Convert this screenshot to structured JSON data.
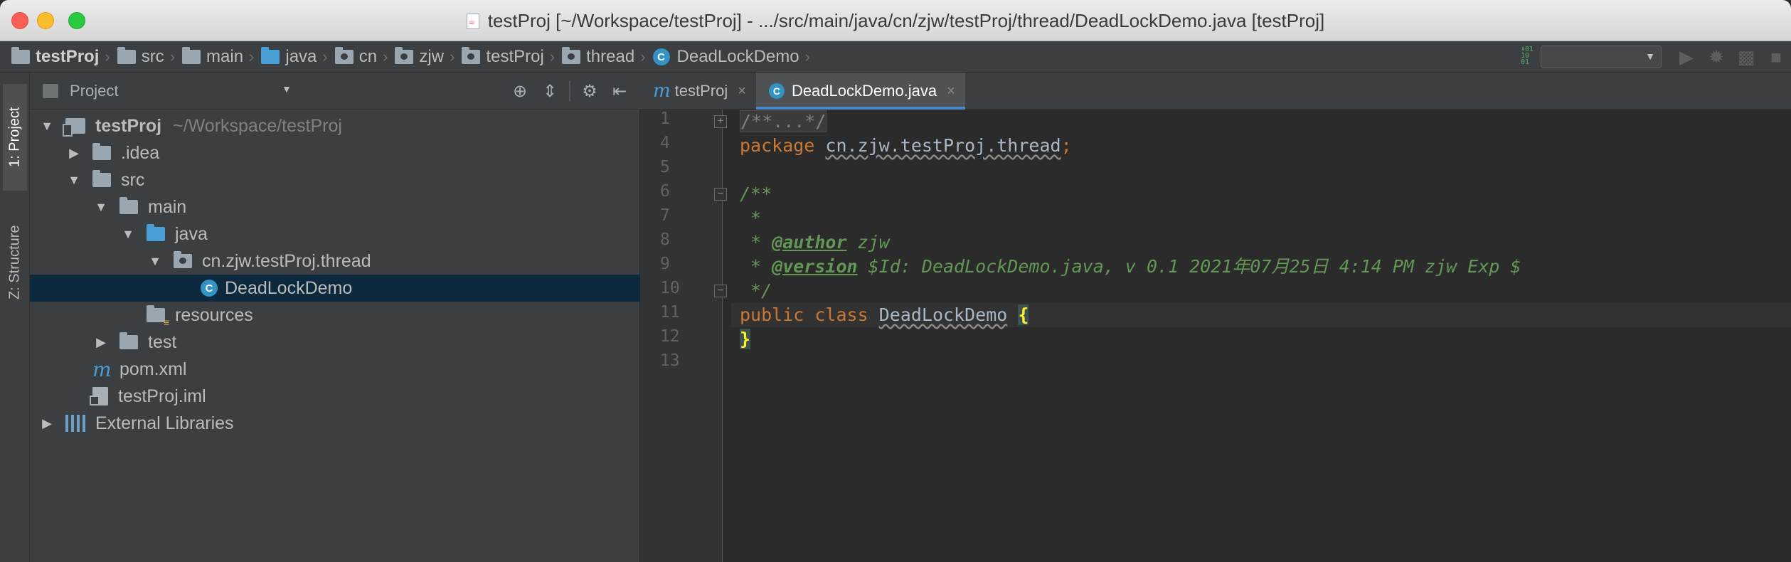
{
  "window": {
    "title": "testProj [~/Workspace/testProj] - .../src/main/java/cn/zjw/testProj/thread/DeadLockDemo.java [testProj]"
  },
  "breadcrumbs": [
    {
      "label": "testProj",
      "icon": "module-folder-icon",
      "bold": true
    },
    {
      "label": "src",
      "icon": "folder-icon"
    },
    {
      "label": "main",
      "icon": "folder-icon"
    },
    {
      "label": "java",
      "icon": "source-folder-icon"
    },
    {
      "label": "cn",
      "icon": "package-icon"
    },
    {
      "label": "zjw",
      "icon": "package-icon"
    },
    {
      "label": "testProj",
      "icon": "package-icon"
    },
    {
      "label": "thread",
      "icon": "package-icon"
    },
    {
      "label": "DeadLockDemo",
      "icon": "class-icon"
    }
  ],
  "left_tool_tabs": {
    "project": "1: Project",
    "structure": "Z: Structure"
  },
  "project_panel": {
    "title": "Project",
    "tree": [
      {
        "label": "testProj",
        "suffix": "~/Workspace/testProj",
        "level": 0,
        "expanded": true,
        "icon": "module-folder-icon"
      },
      {
        "label": ".idea",
        "level": 1,
        "expanded": false,
        "icon": "folder-icon"
      },
      {
        "label": "src",
        "level": 1,
        "expanded": true,
        "icon": "folder-icon"
      },
      {
        "label": "main",
        "level": 2,
        "expanded": true,
        "icon": "folder-icon"
      },
      {
        "label": "java",
        "level": 3,
        "expanded": true,
        "icon": "source-folder-icon"
      },
      {
        "label": "cn.zjw.testProj.thread",
        "level": 4,
        "expanded": true,
        "icon": "package-icon"
      },
      {
        "label": "DeadLockDemo",
        "level": 5,
        "icon": "class-icon",
        "selected": true
      },
      {
        "label": "resources",
        "level": 3,
        "icon": "resources-folder-icon"
      },
      {
        "label": "test",
        "level": 2,
        "expanded": false,
        "icon": "folder-icon"
      },
      {
        "label": "pom.xml",
        "level": 1,
        "icon": "maven-icon"
      },
      {
        "label": "testProj.iml",
        "level": 1,
        "icon": "iml-file-icon"
      },
      {
        "label": "External Libraries",
        "level": 0,
        "expanded": false,
        "icon": "libraries-icon"
      }
    ]
  },
  "editor": {
    "tabs": [
      {
        "label": "testProj",
        "icon": "maven-icon",
        "active": false
      },
      {
        "label": "DeadLockDemo.java",
        "icon": "class-icon",
        "active": true
      }
    ],
    "line_numbers": [
      "1",
      "4",
      "5",
      "6",
      "7",
      "8",
      "9",
      "10",
      "11",
      "12",
      "13"
    ],
    "code": {
      "l1": "/**...*/",
      "l4_kw": "package",
      "l4_pkg": "cn.zjw.testProj.thread",
      "l4_semi": ";",
      "l6": "/**",
      "l7": " *",
      "l8_star": " * ",
      "l8_tag": "@author",
      "l8_val": " zjw",
      "l9_star": " * ",
      "l9_tag": "@version",
      "l9_val": " $Id: DeadLockDemo.java, v 0.1 2021年07月25日 4:14 PM zjw Exp $",
      "l10": " */",
      "l11_kw1": "public",
      "l11_kw2": "class",
      "l11_name": "DeadLockDemo",
      "l11_brace": "{",
      "l12_brace": "}"
    }
  },
  "colors": {
    "keyword": "#cc7832",
    "doc_comment": "#629755",
    "selection": "#0d293e",
    "tab_underline": "#4a88c7"
  }
}
